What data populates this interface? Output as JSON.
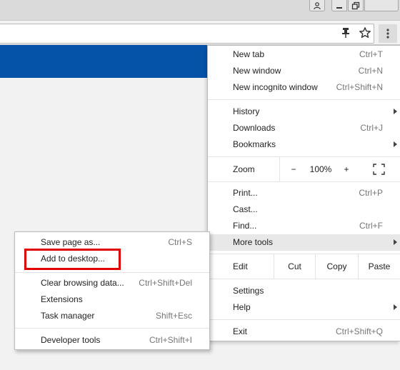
{
  "menu": {
    "items_top": [
      {
        "label": "New tab",
        "shortcut": "Ctrl+T"
      },
      {
        "label": "New window",
        "shortcut": "Ctrl+N"
      },
      {
        "label": "New incognito window",
        "shortcut": "Ctrl+Shift+N"
      }
    ],
    "history": "History",
    "downloads": {
      "label": "Downloads",
      "shortcut": "Ctrl+J"
    },
    "bookmarks": "Bookmarks",
    "zoom": {
      "label": "Zoom",
      "minus": "−",
      "value": "100%",
      "plus": "+"
    },
    "print": {
      "label": "Print...",
      "shortcut": "Ctrl+P"
    },
    "cast": "Cast...",
    "find": {
      "label": "Find...",
      "shortcut": "Ctrl+F"
    },
    "more_tools": "More tools",
    "edit": {
      "label": "Edit",
      "cut": "Cut",
      "copy": "Copy",
      "paste": "Paste"
    },
    "settings": "Settings",
    "help": "Help",
    "exit": {
      "label": "Exit",
      "shortcut": "Ctrl+Shift+Q"
    }
  },
  "submenu": {
    "save_page": {
      "label": "Save page as...",
      "shortcut": "Ctrl+S"
    },
    "add_to_desktop": "Add to desktop...",
    "clear_browsing": {
      "label": "Clear browsing data...",
      "shortcut": "Ctrl+Shift+Del"
    },
    "extensions": "Extensions",
    "task_manager": {
      "label": "Task manager",
      "shortcut": "Shift+Esc"
    },
    "developer_tools": {
      "label": "Developer tools",
      "shortcut": "Ctrl+Shift+I"
    }
  },
  "icons": {
    "user": "person-icon",
    "minimize": "minimize-icon",
    "restore": "restore-icon",
    "pin": "pin-icon",
    "star": "star-icon",
    "menu": "three-dot-menu-icon",
    "fullscreen": "fullscreen-icon"
  },
  "colors": {
    "page_banner": "#0553a8",
    "highlight_box": "#e00000"
  }
}
